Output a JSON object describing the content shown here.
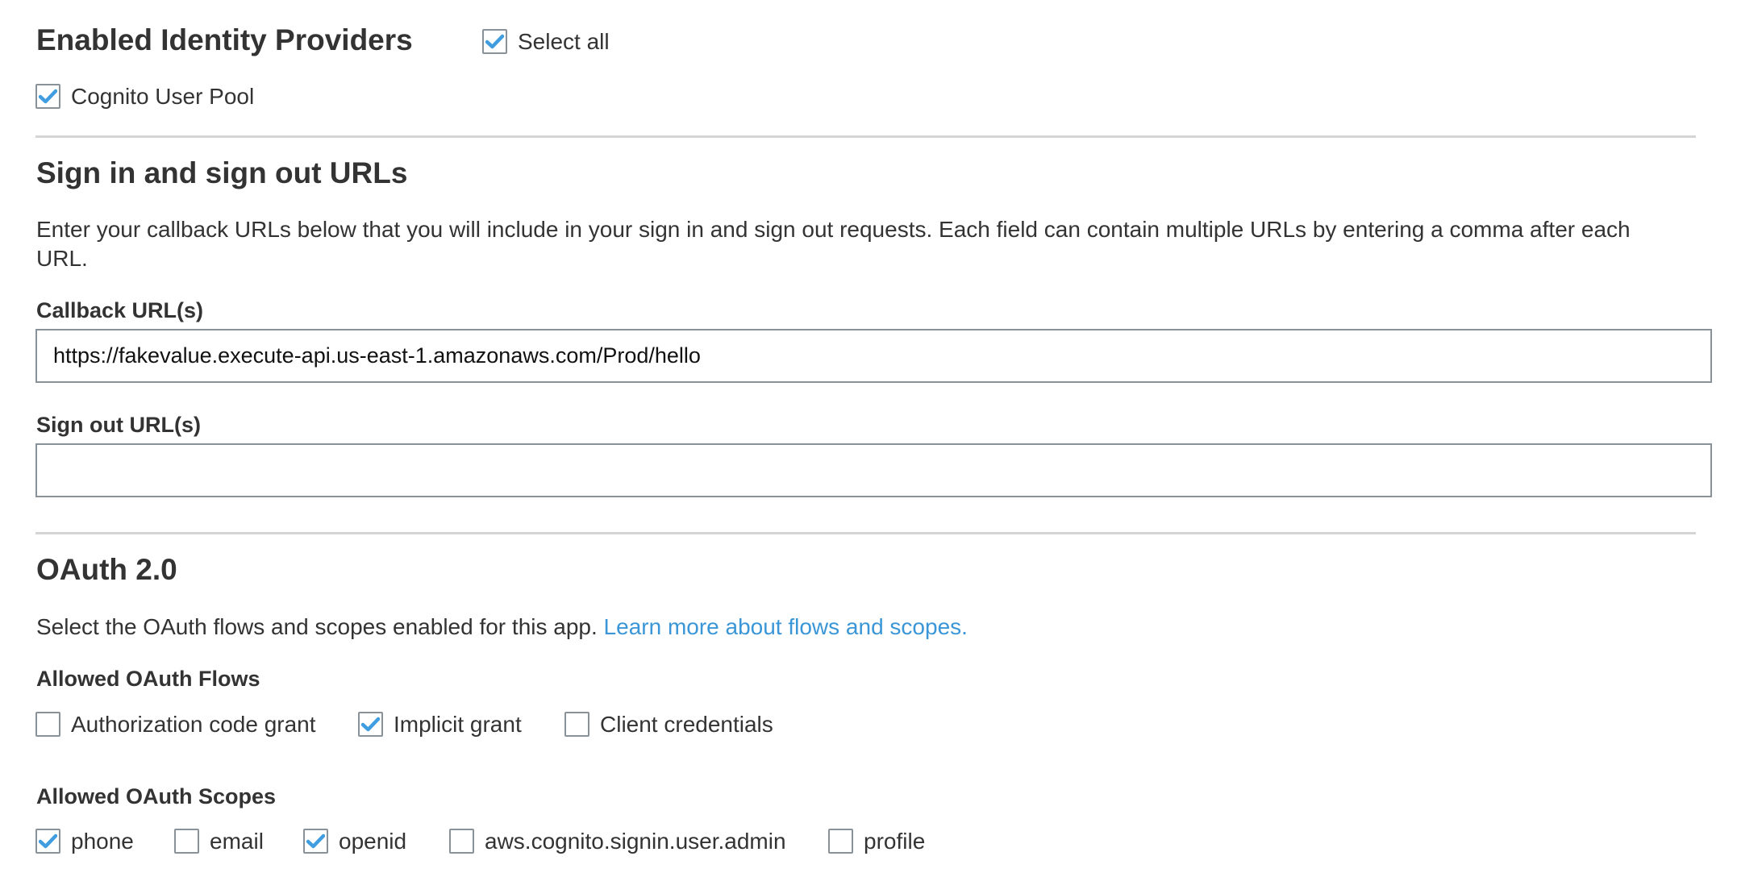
{
  "identity_providers": {
    "title": "Enabled Identity Providers",
    "select_all": {
      "label": "Select all",
      "checked": true
    },
    "providers": [
      {
        "label": "Cognito User Pool",
        "checked": true
      }
    ]
  },
  "urls": {
    "title": "Sign in and sign out URLs",
    "description_line1": "Enter your callback URLs below that you will include in your sign in and sign out requests. Each field can contain multiple URLs by entering a comma after each",
    "description_line2": "URL.",
    "callback": {
      "label": "Callback URL(s)",
      "value": "https://fakevalue.execute-api.us-east-1.amazonaws.com/Prod/hello",
      "placeholder": ""
    },
    "signout": {
      "label": "Sign out URL(s)",
      "value": "",
      "placeholder": ""
    }
  },
  "oauth": {
    "title": "OAuth 2.0",
    "description": "Select the OAuth flows and scopes enabled for this app.",
    "learn_more_link": "Learn more about flows and scopes.",
    "flows_label": "Allowed OAuth Flows",
    "flows": [
      {
        "label": "Authorization code grant",
        "checked": false
      },
      {
        "label": "Implicit grant",
        "checked": true
      },
      {
        "label": "Client credentials",
        "checked": false
      }
    ],
    "scopes_label": "Allowed OAuth Scopes",
    "scopes": [
      {
        "label": "phone",
        "checked": true
      },
      {
        "label": "email",
        "checked": false
      },
      {
        "label": "openid",
        "checked": true
      },
      {
        "label": "aws.cognito.signin.user.admin",
        "checked": false
      },
      {
        "label": "profile",
        "checked": false
      }
    ]
  },
  "colors": {
    "text": "#333333",
    "checkmark": "#3f9de0",
    "checkbox_border": "#8a9299",
    "divider": "#d5d5d5",
    "link": "#3a96d6"
  }
}
